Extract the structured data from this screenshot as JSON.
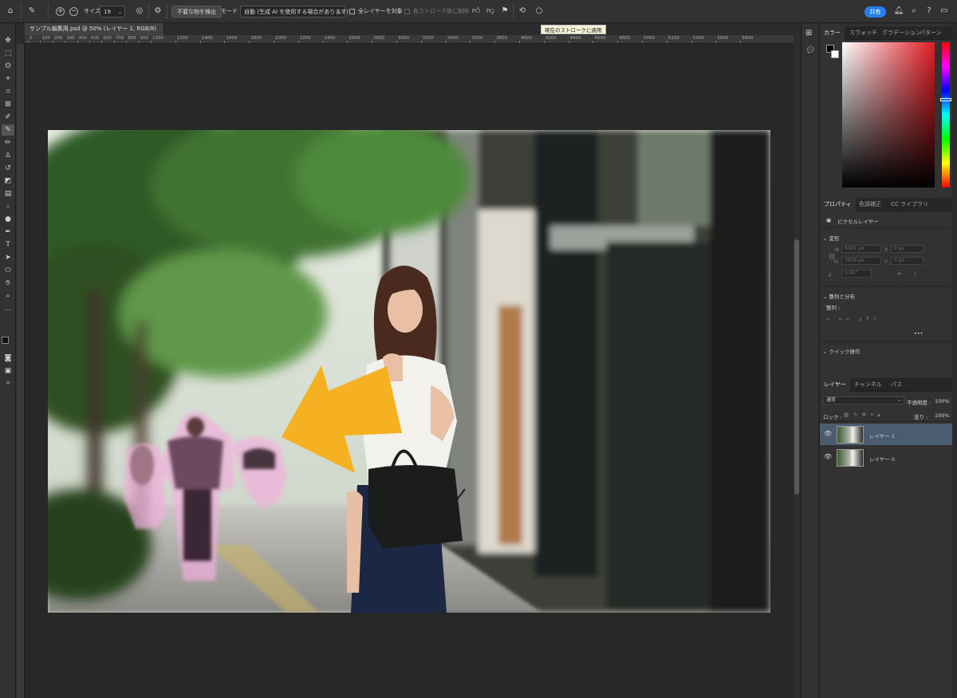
{
  "options_bar": {
    "size_label": "サイズ",
    "size_value": "19",
    "detect_button": "不要な物を検出",
    "mode_label": "モード",
    "mode_value": "自動 (生成 AI を使用する場合があります)",
    "all_layers_label": "全レイヤーを対象",
    "after_stroke_label": "各ストローク後に削除",
    "share_label": "共有",
    "tooltip": "現在のストロークに適用"
  },
  "document": {
    "tab_title": "サンプル編集用.psd @ 50% (レイヤー 1, RGB/8)"
  },
  "ruler": {
    "ticks": [
      "0",
      "100",
      "200",
      "300",
      "400",
      "500",
      "600",
      "700",
      "800",
      "900",
      "1000",
      "1200",
      "1400",
      "1600",
      "1800",
      "2000",
      "2200",
      "2400",
      "2600",
      "2800",
      "3000",
      "3200",
      "3400",
      "3600",
      "3800",
      "4000",
      "4200",
      "4400",
      "4600",
      "4800",
      "5000",
      "5200",
      "5400",
      "5600",
      "5800"
    ]
  },
  "color_panel": {
    "tabs": [
      "カラー",
      "スウォッチ",
      "グラデーション",
      "パターン"
    ],
    "hue_color": "#e31c24"
  },
  "properties_panel": {
    "tabs": [
      "プロパティ",
      "色調補正",
      "CC ライブラリ"
    ],
    "layer_type": "ピクセルレイヤー",
    "transform_title": "変形",
    "w_label": "W",
    "w_value": "6901 px",
    "x_label": "X",
    "x_value": "0 px",
    "h_label": "H",
    "h_value": "3934 px",
    "y_label": "Y",
    "y_value": "0 px",
    "angle_value": "0.00°",
    "align_title": "整列と分布",
    "align_label": "整列 :",
    "more": "•••",
    "quick_actions": "クイック操作"
  },
  "layers_panel": {
    "tabs": [
      "レイヤー",
      "チャンネル",
      "パス"
    ],
    "blend_mode": "通常",
    "opacity_label": "不透明度 :",
    "opacity_value": "100%",
    "lock_label": "ロック :",
    "fill_label": "塗り :",
    "fill_value": "100%",
    "layers": [
      {
        "name": "レイヤー 1",
        "selected": true
      },
      {
        "name": "レイヤー 0",
        "selected": false
      }
    ]
  },
  "colors": {
    "accent": "#2680eb",
    "arrow": "#f6b122",
    "selection_tint": "#ffb6e6"
  }
}
